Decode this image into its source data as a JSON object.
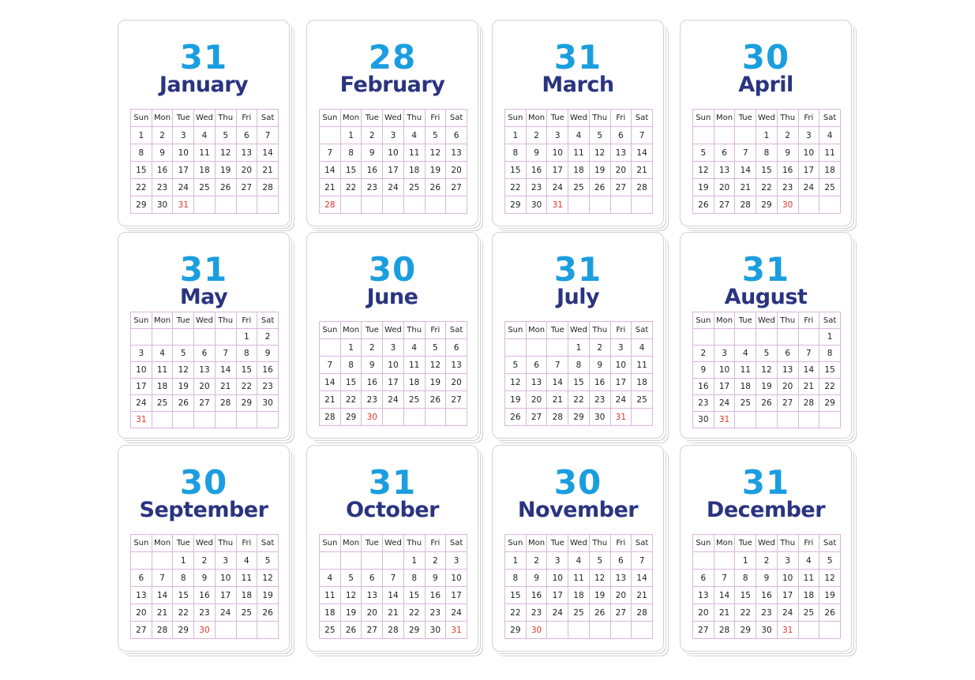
{
  "weekdays": [
    "Sun",
    "Mon",
    "Tue",
    "Wed",
    "Thu",
    "Fri",
    "Sat"
  ],
  "colors": {
    "day_count": "#1b9ee0",
    "month_name": "#2a3480",
    "last_day": "#e1332b",
    "grid": "#d9b6dc"
  },
  "months": [
    {
      "count": "31",
      "name": "January",
      "start": 0,
      "days": 31
    },
    {
      "count": "28",
      "name": "February",
      "start": 1,
      "days": 28
    },
    {
      "count": "31",
      "name": "March",
      "start": 0,
      "days": 31
    },
    {
      "count": "30",
      "name": "April",
      "start": 3,
      "days": 30
    },
    {
      "count": "31",
      "name": "May",
      "start": 5,
      "days": 31
    },
    {
      "count": "30",
      "name": "June",
      "start": 1,
      "days": 30
    },
    {
      "count": "31",
      "name": "July",
      "start": 3,
      "days": 31
    },
    {
      "count": "31",
      "name": "August",
      "start": 6,
      "days": 31
    },
    {
      "count": "30",
      "name": "September",
      "start": 2,
      "days": 30
    },
    {
      "count": "31",
      "name": "October",
      "start": 4,
      "days": 31
    },
    {
      "count": "30",
      "name": "November",
      "start": 0,
      "days": 30
    },
    {
      "count": "31",
      "name": "December",
      "start": 2,
      "days": 31
    }
  ]
}
